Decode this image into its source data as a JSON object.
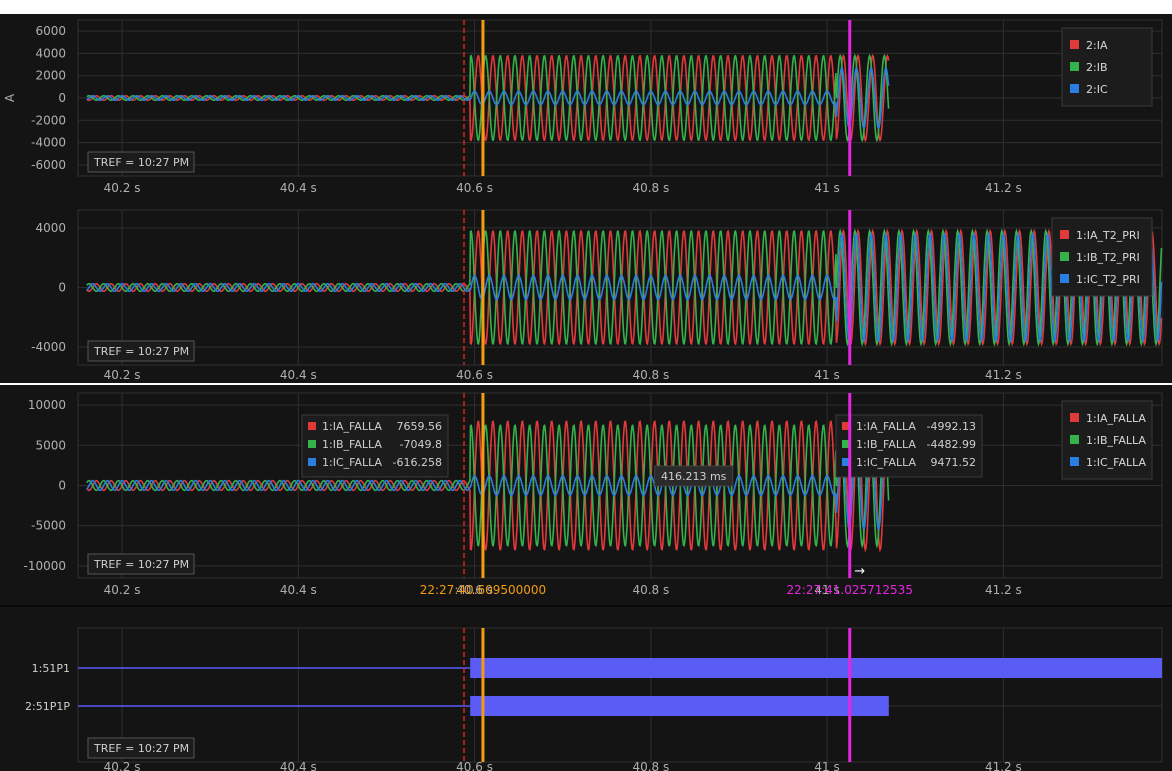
{
  "colors": {
    "background": "#141414",
    "grid": "#2f2f2f",
    "red": "#e03a3a",
    "green": "#35b24a",
    "blue": "#2a7de1",
    "cursor_orange": "#f39c12",
    "cursor_magenta": "#e426e0",
    "cursor_red_dashed": "#e02020",
    "digital": "#5b5bf5",
    "separator": "#ffffff"
  },
  "tref_label": "TREF = 10:27 PM",
  "x_ticks": [
    "40.2 s",
    "40.4 s",
    "40.6 s",
    "40.8 s",
    "41 s",
    "41.2 s"
  ],
  "cursors": {
    "orange_label": "22:27:40.609500000",
    "magenta_label": "22:27:41.025712535",
    "delta_label": "416.213 ms"
  },
  "chart_data": [
    {
      "type": "line",
      "panel": "1",
      "ylabel": "A",
      "yticks": [
        "6000",
        "4000",
        "2000",
        "0",
        "-2000",
        "-4000",
        "-6000"
      ],
      "ylim": [
        -7000,
        7000
      ],
      "xlim": [
        40.15,
        41.38
      ],
      "series": [
        {
          "name": "2:IA",
          "color": "red",
          "pre_fault_amplitude": 200,
          "fault_amplitude": 3800,
          "phase_deg": 0
        },
        {
          "name": "2:IB",
          "color": "green",
          "pre_fault_amplitude": 200,
          "fault_amplitude": 3800,
          "phase_deg": 180
        },
        {
          "name": "2:IC",
          "color": "blue",
          "pre_fault_amplitude": 200,
          "fault_amplitude": 600,
          "phase_deg": 90
        }
      ],
      "events": {
        "fault_start_s": 40.595,
        "second_event_s": 41.01,
        "record_end_s": 41.07
      },
      "frequency_hz": 60,
      "legend_position": "top-right"
    },
    {
      "type": "line",
      "panel": "2",
      "yticks": [
        "4000",
        "0",
        "-4000"
      ],
      "ylim": [
        -5200,
        5200
      ],
      "xlim": [
        40.15,
        41.38
      ],
      "series": [
        {
          "name": "1:IA_T2_PRI",
          "color": "red",
          "pre_fault_amplitude": 250,
          "fault_amplitude": 3800,
          "phase_deg": 0
        },
        {
          "name": "1:IB_T2_PRI",
          "color": "green",
          "pre_fault_amplitude": 250,
          "fault_amplitude": 3800,
          "phase_deg": 180
        },
        {
          "name": "1:IC_T2_PRI",
          "color": "blue",
          "pre_fault_amplitude": 250,
          "fault_amplitude": 800,
          "phase_deg": 90
        }
      ],
      "events": {
        "fault_start_s": 40.595,
        "second_event_s": 41.01,
        "record_end_s": 41.38
      },
      "frequency_hz": 60,
      "legend_position": "top-right"
    },
    {
      "type": "line",
      "panel": "3",
      "yticks": [
        "10000",
        "5000",
        "0",
        "-5000",
        "-10000"
      ],
      "ylim": [
        -11500,
        11500
      ],
      "xlim": [
        40.15,
        41.38
      ],
      "series": [
        {
          "name": "1:IA_FALLA",
          "color": "red",
          "pre_fault_amplitude": 600,
          "fault_amplitude": 8000,
          "phase_deg": 0
        },
        {
          "name": "1:IB_FALLA",
          "color": "green",
          "pre_fault_amplitude": 600,
          "fault_amplitude": 7500,
          "phase_deg": 180
        },
        {
          "name": "1:IC_FALLA",
          "color": "blue",
          "pre_fault_amplitude": 600,
          "fault_amplitude": 1200,
          "phase_deg": 90
        }
      ],
      "events": {
        "fault_start_s": 40.595,
        "second_event_s": 41.01,
        "record_end_s": 41.07
      },
      "frequency_hz": 60,
      "legend_position": "top-right",
      "cursor_readouts": [
        {
          "at": "orange",
          "rows": [
            {
              "name": "1:IA_FALLA",
              "value": "7659.56",
              "color": "red"
            },
            {
              "name": "1:IB_FALLA",
              "value": "-7049.8",
              "color": "green"
            },
            {
              "name": "1:IC_FALLA",
              "value": "-616.258",
              "color": "blue"
            }
          ]
        },
        {
          "at": "magenta",
          "rows": [
            {
              "name": "1:IA_FALLA",
              "value": "-4992.13",
              "color": "red"
            },
            {
              "name": "1:IB_FALLA",
              "value": "-4482.99",
              "color": "green"
            },
            {
              "name": "1:IC_FALLA",
              "value": "9471.52",
              "color": "blue"
            }
          ]
        }
      ]
    },
    {
      "type": "digital",
      "panel": "4",
      "xlim": [
        40.15,
        41.38
      ],
      "channels": [
        {
          "name": "1:51P1",
          "asserted_from_s": 40.595,
          "asserted_to_s": 41.38
        },
        {
          "name": "2:51P1P",
          "asserted_from_s": 40.595,
          "asserted_to_s": 41.07
        }
      ]
    }
  ]
}
